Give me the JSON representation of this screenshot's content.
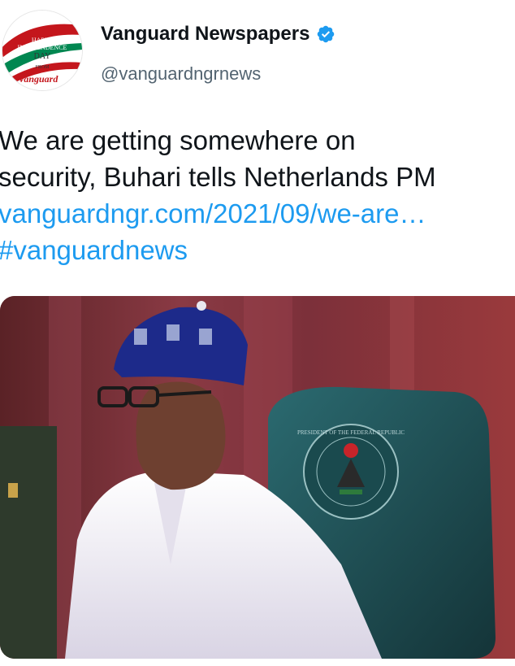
{
  "author": {
    "display_name": "Vanguard Newspapers",
    "handle": "@vanguardngrnews",
    "verified_icon": "verified-badge-icon",
    "avatar": {
      "line1": "HAPPY",
      "line2": "INDEPENDENCE",
      "line3": "DAY",
      "line4": "FROM",
      "brand": "Vanguard",
      "colors": {
        "red": "#c4161c",
        "green": "#008751",
        "white": "#ffffff"
      }
    }
  },
  "tweet": {
    "text_line1": "We are getting somewhere on",
    "text_line2": "security, Buhari tells Netherlands PM",
    "link": "vanguardngr.com/2021/09/we-are…",
    "hashtag": "#vanguardnews"
  },
  "media": {
    "seal_text": "PRESIDENT OF THE FEDERAL REPUBLIC",
    "colors": {
      "background": "#7a2e34",
      "chair": "#1f4f55",
      "garment": "#f3f1f5",
      "cap": "#1d2a8a"
    }
  },
  "colors": {
    "text": "#0f1419",
    "secondary": "#536471",
    "link": "#1d9bf0",
    "verified": "#1d9bf0"
  }
}
